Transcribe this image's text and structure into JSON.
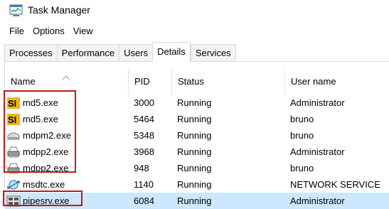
{
  "window": {
    "title": "Task Manager"
  },
  "menu": [
    "File",
    "Options",
    "View"
  ],
  "tabs": [
    {
      "label": "Processes",
      "active": false
    },
    {
      "label": "Performance",
      "active": false
    },
    {
      "label": "Users",
      "active": false
    },
    {
      "label": "Details",
      "active": true
    },
    {
      "label": "Services",
      "active": false
    }
  ],
  "columns": {
    "name": "Name",
    "pid": "PID",
    "status": "Status",
    "user": "User name"
  },
  "processes": [
    {
      "name": "md5.exe",
      "pid": "3000",
      "status": "Running",
      "user": "Administrator",
      "icon": "si-icon"
    },
    {
      "name": "md5.exe",
      "pid": "5464",
      "status": "Running",
      "user": "bruno",
      "icon": "si-icon"
    },
    {
      "name": "mdpm2.exe",
      "pid": "5348",
      "status": "Running",
      "user": "bruno",
      "icon": "scanner-icon"
    },
    {
      "name": "mdpp2.exe",
      "pid": "3968",
      "status": "Running",
      "user": "Administrator",
      "icon": "printer-icon"
    },
    {
      "name": "mdpp2.exe",
      "pid": "948",
      "status": "Running",
      "user": "bruno",
      "icon": "printer-icon"
    },
    {
      "name": "msdtc.exe",
      "pid": "1140",
      "status": "Running",
      "user": "NETWORK SERVICE",
      "icon": "network-icon"
    },
    {
      "name": "pipesrv.exe",
      "pid": "6084",
      "status": "Running",
      "user": "Administrator",
      "icon": "service-icon",
      "selected": true
    }
  ],
  "colors": {
    "selection": "#cce8ff",
    "highlight_box": "#c11a1a",
    "si_icon_bg": "#f2b700"
  }
}
